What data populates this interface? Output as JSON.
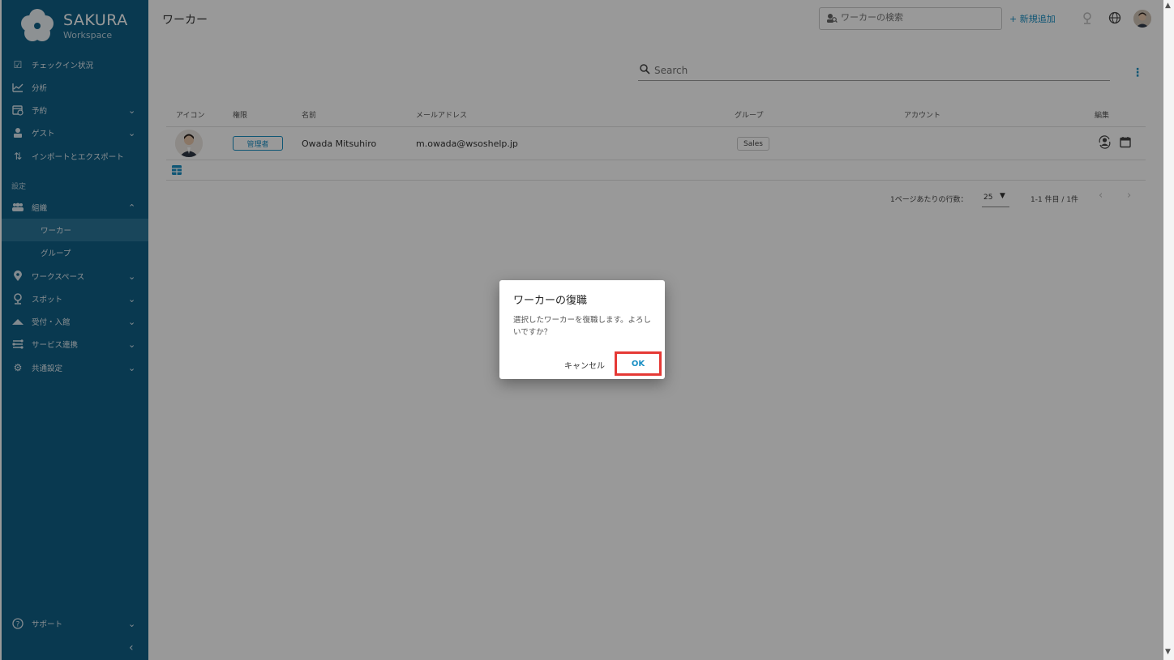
{
  "brand": {
    "title": "SAKURA",
    "subtitle": "Workspace"
  },
  "sidebar": {
    "items": [
      {
        "label": "チェックイン状況",
        "icon": "checkbox-icon"
      },
      {
        "label": "分析",
        "icon": "chart-line-icon"
      },
      {
        "label": "予約",
        "icon": "calendar-clock-icon",
        "expandable": true
      },
      {
        "label": "ゲスト",
        "icon": "guest-icon",
        "expandable": true
      },
      {
        "label": "インポートとエクスポート",
        "icon": "import-export-icon"
      }
    ],
    "section_label": "設定",
    "settings_items": [
      {
        "label": "組織",
        "icon": "people-icon",
        "expanded": true
      },
      {
        "label": "ワーカー",
        "sub": true,
        "active": true
      },
      {
        "label": "グループ",
        "sub": true
      },
      {
        "label": "ワークスペース",
        "icon": "map-pin-icon",
        "expandable": true
      },
      {
        "label": "スポット",
        "icon": "spot-pin-icon",
        "expandable": true
      },
      {
        "label": "受付・入館",
        "icon": "reception-icon",
        "expandable": true
      },
      {
        "label": "サービス連携",
        "icon": "integration-icon",
        "expandable": true
      },
      {
        "label": "共通設定",
        "icon": "gears-icon",
        "expandable": true
      }
    ],
    "support_label": "サポート",
    "collapse_symbol": "‹"
  },
  "header": {
    "title": "ワーカー",
    "search_placeholder": "ワーカーの検索",
    "add_label": "+ 新規追加"
  },
  "table": {
    "search_placeholder": "Search",
    "columns": [
      "アイコン",
      "権限",
      "名前",
      "メールアドレス",
      "グループ",
      "アカウント",
      "編集"
    ],
    "rows": [
      {
        "role": "管理者",
        "name": "Owada Mitsuhiro",
        "email": "m.owada@wsoshelp.jp",
        "group": "Sales",
        "account": ""
      }
    ]
  },
  "pagination": {
    "rows_per_page_label": "1ページあたりの行数：",
    "rows_per_page": "25",
    "range": "1-1 件目 / 1件"
  },
  "dialog": {
    "title": "ワーカーの復職",
    "message": "選択したワーカーを復職します。よろしいですか？",
    "cancel_label": "キャンセル",
    "ok_label": "OK"
  },
  "colors": {
    "sidebar": "#0f5f85",
    "accent": "#1a8fc4",
    "highlight": "#e53935"
  }
}
